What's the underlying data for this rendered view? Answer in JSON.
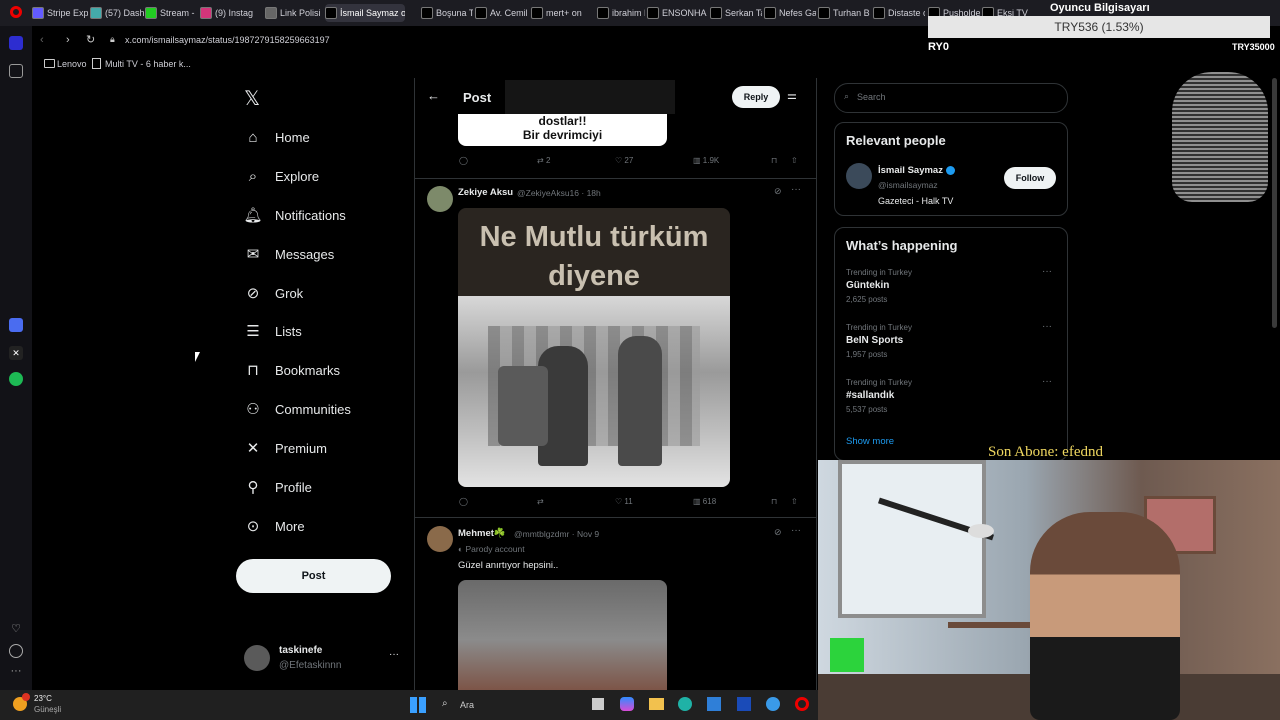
{
  "browser": {
    "tabs": [
      {
        "label": "Stripe Exp",
        "color": "#635bff"
      },
      {
        "label": "(57) Dash",
        "color": "#4aa"
      },
      {
        "label": "Stream -",
        "color": "#2c2"
      },
      {
        "label": "(9) Instag",
        "color": "#d3357a"
      },
      {
        "label": "Link Polisi",
        "color": "#666"
      },
      {
        "label": "İsmail Saymaz on",
        "color": "#000"
      },
      {
        "label": "Boşuna T",
        "color": "#000"
      },
      {
        "label": "Av. Cemil",
        "color": "#000"
      },
      {
        "label": "mert+ on",
        "color": "#000"
      },
      {
        "label": "ibrahim H",
        "color": "#000"
      },
      {
        "label": "ENSONHA",
        "color": "#000"
      },
      {
        "label": "Serkan Ta",
        "color": "#000"
      },
      {
        "label": "Nefes Ga",
        "color": "#000"
      },
      {
        "label": "Turhan Bc",
        "color": "#000"
      },
      {
        "label": "Distaste c",
        "color": "#000"
      },
      {
        "label": "Pusholde",
        "color": "#000"
      },
      {
        "label": "Ekşi TV c",
        "color": "#000"
      }
    ],
    "url": "x.com/ismailsaymaz/status/1987279158259663197",
    "bookmarks": [
      "Lenovo",
      "Multi TV - 6 haber k..."
    ]
  },
  "nav": {
    "items": [
      {
        "label": "Home",
        "icon": "home-icon"
      },
      {
        "label": "Explore",
        "icon": "search-icon"
      },
      {
        "label": "Notifications",
        "icon": "bell-icon"
      },
      {
        "label": "Messages",
        "icon": "mail-icon"
      },
      {
        "label": "Grok",
        "icon": "grok-icon"
      },
      {
        "label": "Lists",
        "icon": "list-icon"
      },
      {
        "label": "Bookmarks",
        "icon": "bookmark-icon"
      },
      {
        "label": "Communities",
        "icon": "people-icon"
      },
      {
        "label": "Premium",
        "icon": "x-icon"
      },
      {
        "label": "Profile",
        "icon": "person-icon"
      },
      {
        "label": "More",
        "icon": "more-circle-icon"
      }
    ],
    "post_label": "Post",
    "account": {
      "name": "taskinefe",
      "handle": "@Efetaskinnn"
    }
  },
  "header": {
    "title": "Post",
    "reply_label": "Reply"
  },
  "prev_post": {
    "image_text_1": "dostlar!!",
    "image_text_2": "Bir devrimciyi",
    "retweets": "2",
    "likes": "27",
    "views": "1.9K"
  },
  "post1": {
    "name": "Zekiye Aksu",
    "handle": "@ZekiyeAksu16",
    "time": "18h",
    "image_title": "Ne Mutlu türküm diyene",
    "likes": "11",
    "views": "618"
  },
  "post2": {
    "name": "Mehmet☘️",
    "handle": "@mmtblgzdmr",
    "time": "Nov 9",
    "badge": "Parody account",
    "text": "Güzel anırtıyor hepsini.."
  },
  "right": {
    "search_placeholder": "Search",
    "relevant_title": "Relevant people",
    "person": {
      "name": "İsmail Saymaz",
      "handle": "@ismailsaymaz",
      "bio": "Gazeteci - Halk TV",
      "follow_label": "Follow"
    },
    "happening_title": "What’s happening",
    "trends": [
      {
        "label": "Trending in Turkey",
        "name": "Güntekin",
        "posts": "2,625 posts"
      },
      {
        "label": "Trending in Turkey",
        "name": "BeIN Sports",
        "posts": "1,957 posts"
      },
      {
        "label": "Trending in Turkey",
        "name": "#sallandık",
        "posts": "5,537 posts"
      }
    ],
    "show_more": "Show more"
  },
  "taskbar": {
    "weather_temp": "23°C",
    "weather_desc": "Güneşli",
    "search_label": "Ara"
  },
  "overlay": {
    "ticker": "TRY536 (1.53%)",
    "title": "Oyuncu Bilgisayarı",
    "ticker_left": "RY0",
    "ticker_right": "TRY35000",
    "sub_text": "Son Abone: efednd"
  }
}
